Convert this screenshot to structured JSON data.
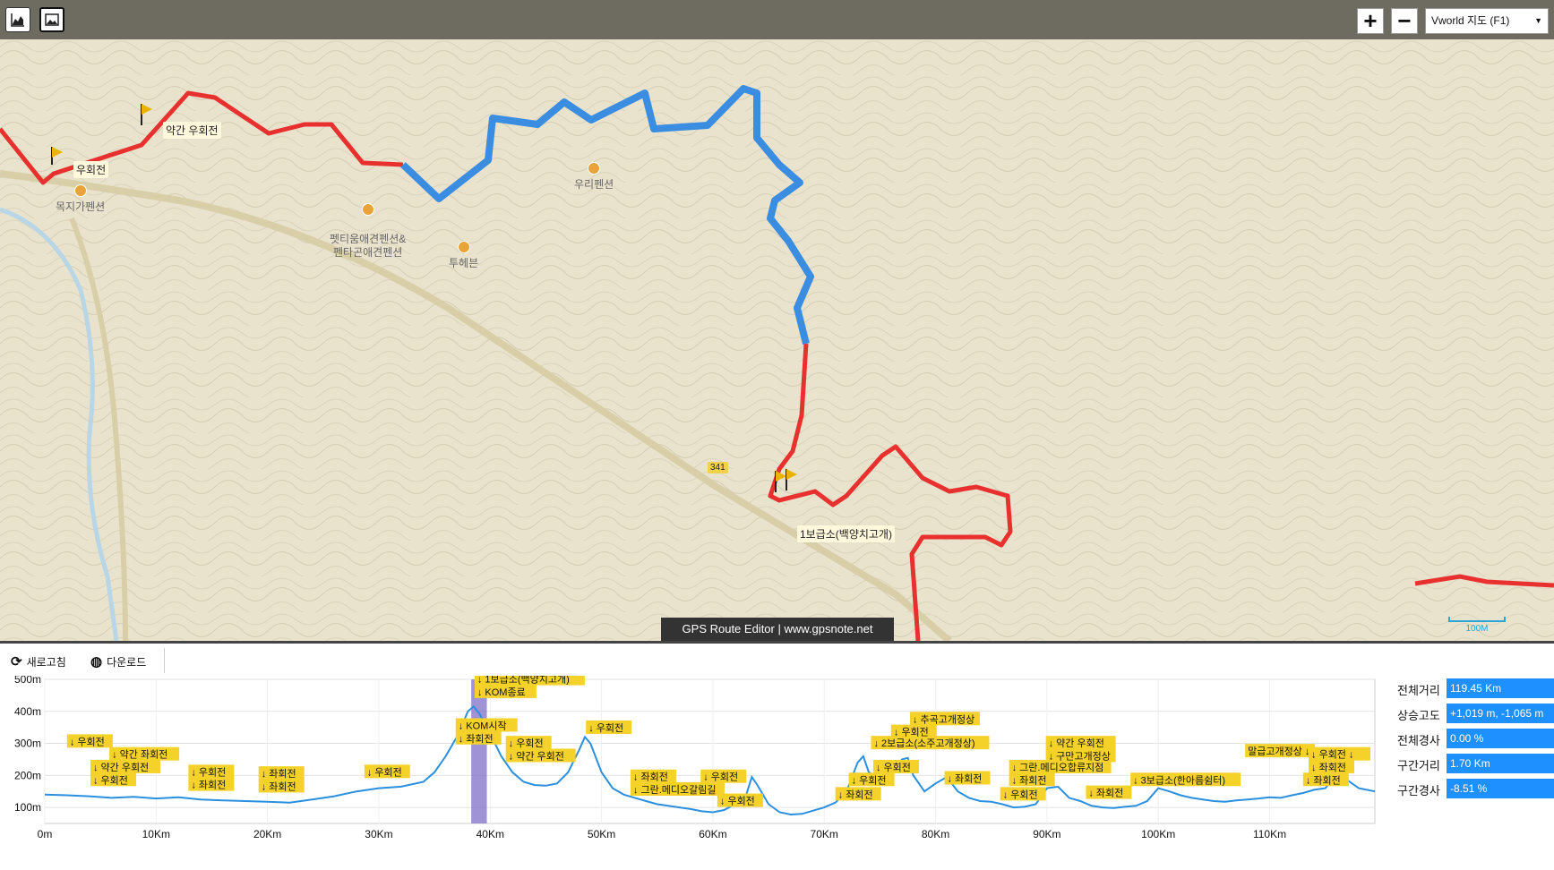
{
  "topbar": {
    "chart_icon": "chart-line-icon",
    "image_icon": "image-icon",
    "zoom_in": "+",
    "zoom_out": "−",
    "map_type": "Vworld 지도 (F1)"
  },
  "map": {
    "pois": [
      {
        "name": "목지가펜션"
      },
      {
        "name": "펫티움애견펜션&\n펜타곤애견펜션"
      },
      {
        "name": "투헤븐"
      },
      {
        "name": "우리펜션"
      }
    ],
    "waypoints": [
      "약간 우회전",
      "우회전",
      "1보급소(백양치고개)"
    ],
    "road_number": "341",
    "credit": "GPS Route Editor | www.gpsnote.net",
    "scale": "100M"
  },
  "toolbar": {
    "refresh": "새로고침",
    "download": "다운로드"
  },
  "stats": {
    "labels": [
      "전체거리",
      "상승고도",
      "전체경사",
      "구간거리",
      "구간경사"
    ],
    "values": [
      "119.45 Km",
      "+1,019 m, -1,065 m",
      "0.00 %",
      "1.70 Km",
      "-8.51 %"
    ]
  },
  "colors": {
    "route_red": "#e8312f",
    "route_blue": "#3a8de0",
    "profile_line": "#2a8fde",
    "cue_bg": "#f5d22a",
    "selection": "#7f6fc8"
  },
  "chart_data": {
    "type": "line",
    "y_ticks": [
      "500m",
      "400m",
      "300m",
      "200m",
      "100m"
    ],
    "x_ticks": [
      "0m",
      "10Km",
      "20Km",
      "30Km",
      "40Km",
      "50Km",
      "60Km",
      "70Km",
      "80Km",
      "90Km",
      "100Km",
      "110Km"
    ],
    "ylim": [
      50,
      500
    ],
    "xlim": [
      0,
      119.45
    ],
    "x": [
      0,
      2,
      4,
      6,
      8,
      10,
      12,
      14,
      16,
      18,
      20,
      22,
      24,
      26,
      28,
      30,
      32,
      34,
      35,
      36,
      37,
      37.5,
      38,
      38.5,
      39,
      40,
      41,
      42,
      43,
      44,
      45,
      46,
      47,
      48,
      48.5,
      49,
      50,
      51,
      52,
      53,
      54,
      55,
      56,
      57,
      58,
      59,
      60,
      61,
      62,
      63,
      63.5,
      64,
      65,
      66,
      67,
      68,
      69,
      70,
      71,
      72,
      73,
      73.5,
      74,
      75,
      76,
      77,
      77.5,
      78,
      79,
      80,
      81,
      82,
      83,
      84,
      85,
      86,
      87,
      88,
      89,
      90,
      91,
      92,
      93,
      94,
      95,
      96,
      97,
      98,
      99,
      100,
      101,
      102,
      103,
      104,
      105,
      106,
      107,
      108,
      109,
      110,
      111,
      112,
      113,
      114,
      115,
      116,
      117,
      118,
      119.45
    ],
    "y": [
      140,
      138,
      135,
      130,
      133,
      128,
      132,
      125,
      122,
      120,
      118,
      115,
      125,
      135,
      150,
      160,
      165,
      180,
      210,
      260,
      320,
      360,
      400,
      415,
      395,
      330,
      260,
      210,
      180,
      170,
      168,
      175,
      210,
      280,
      320,
      300,
      210,
      160,
      140,
      130,
      120,
      110,
      105,
      100,
      95,
      88,
      85,
      92,
      110,
      140,
      195,
      170,
      110,
      85,
      78,
      80,
      90,
      100,
      115,
      150,
      240,
      260,
      210,
      190,
      215,
      250,
      255,
      200,
      150,
      175,
      195,
      150,
      130,
      120,
      118,
      110,
      100,
      102,
      110,
      160,
      165,
      130,
      120,
      105,
      100,
      98,
      102,
      105,
      120,
      160,
      150,
      138,
      130,
      125,
      120,
      118,
      122,
      125,
      128,
      132,
      130,
      138,
      145,
      155,
      160,
      200,
      185,
      160,
      150,
      140
    ],
    "cue_labels": [
      {
        "text": "↓ 우회전",
        "x": 2.0,
        "y": 295
      },
      {
        "text": "↓ 약간 좌회전",
        "x": 5.8,
        "y": 255
      },
      {
        "text": "↓ 약간 우회전",
        "x": 4.1,
        "y": 215
      },
      {
        "text": "↓ 우회전",
        "x": 4.1,
        "y": 175
      },
      {
        "text": "↓ 우회전",
        "x": 12.9,
        "y": 200
      },
      {
        "text": "↓ 좌회전",
        "x": 12.9,
        "y": 160
      },
      {
        "text": "↓ 좌회전",
        "x": 19.2,
        "y": 195
      },
      {
        "text": "↓ 좌회전",
        "x": 19.2,
        "y": 155
      },
      {
        "text": "↓ 우회전",
        "x": 28.7,
        "y": 200
      },
      {
        "text": "↓ 1보급소(백양치고개)",
        "x": 38.6,
        "y": 490
      },
      {
        "text": "↓ KOM종료",
        "x": 38.6,
        "y": 450
      },
      {
        "text": "↓ KOM시작",
        "x": 36.9,
        "y": 345
      },
      {
        "text": "↓ 좌회전",
        "x": 36.9,
        "y": 305
      },
      {
        "text": "↓ 우회전",
        "x": 41.4,
        "y": 290
      },
      {
        "text": "↓ 약간 우회전",
        "x": 41.4,
        "y": 250
      },
      {
        "text": "↓ 우회전",
        "x": 48.6,
        "y": 338
      },
      {
        "text": "↓ 좌회전",
        "x": 52.6,
        "y": 185
      },
      {
        "text": "↓ 그란.메디오갈림길",
        "x": 52.6,
        "y": 145
      },
      {
        "text": "↓ 우회전",
        "x": 58.9,
        "y": 185
      },
      {
        "text": "↓ 우회전",
        "x": 60.4,
        "y": 110
      },
      {
        "text": "↓ 좌회전",
        "x": 71.0,
        "y": 130
      },
      {
        "text": "↓ 우회전",
        "x": 72.2,
        "y": 175
      },
      {
        "text": "↓ 2보급소(소주고개정상)",
        "x": 74.2,
        "y": 290
      },
      {
        "text": "↓ 우회전",
        "x": 76.0,
        "y": 325
      },
      {
        "text": "↓ 추곡고개정상",
        "x": 77.7,
        "y": 365
      },
      {
        "text": "↓ 우회전",
        "x": 74.4,
        "y": 215
      },
      {
        "text": "↓ 좌회전",
        "x": 80.8,
        "y": 180
      },
      {
        "text": "↓ 우회전",
        "x": 85.8,
        "y": 130
      },
      {
        "text": "↓ 그란.메디오합류지점",
        "x": 86.6,
        "y": 215
      },
      {
        "text": "↓ 좌회전",
        "x": 86.6,
        "y": 175
      },
      {
        "text": "↓ 약간 우회전",
        "x": 89.9,
        "y": 290
      },
      {
        "text": "↓ 구만고개정상",
        "x": 89.9,
        "y": 250
      },
      {
        "text": "↓ 좌회전",
        "x": 93.5,
        "y": 135
      },
      {
        "text": "↓ 3보급소(한아름쉼터)",
        "x": 97.5,
        "y": 175
      },
      {
        "text": "말급고개정상 ↓",
        "x": 107.8,
        "y": 265
      },
      {
        "text": "↓ 우회전 ↓",
        "x": 113.5,
        "y": 255
      },
      {
        "text": "↓ 좌회전",
        "x": 113.5,
        "y": 215
      },
      {
        "text": "↓ 좌회전",
        "x": 113.0,
        "y": 175
      }
    ],
    "selection": [
      38.3,
      39.7
    ]
  }
}
